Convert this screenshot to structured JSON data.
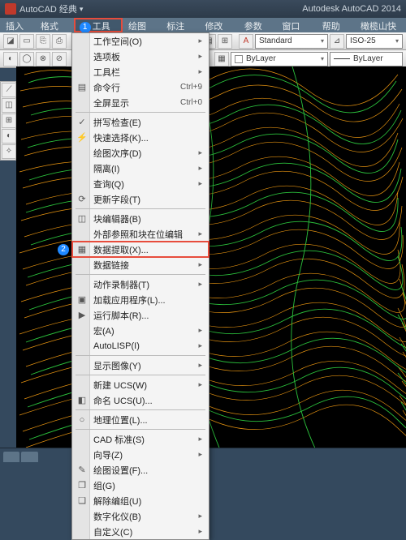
{
  "titlebar": {
    "left": "AutoCAD 经典",
    "right": "Autodesk AutoCAD 2014"
  },
  "menubar": {
    "items": [
      "插入(I)",
      "格式(O)",
      "工具(T)",
      "绘图(D)",
      "标注(N)",
      "修改(M)",
      "参数(P)",
      "窗口(W)",
      "帮助(H)",
      "橄榄山快模"
    ],
    "highlight_index": 2,
    "marker": "1"
  },
  "toolbar2": {
    "combo_standard": "Standard",
    "combo_iso": "ISO-25",
    "combo_bylayer1": "ByLayer",
    "combo_bylayer2": "ByLayer"
  },
  "dropdown": {
    "marker": "2",
    "groups": [
      [
        {
          "label": "工作空间(O)",
          "sub": "▸",
          "icon": ""
        },
        {
          "label": "选项板",
          "sub": "▸",
          "icon": ""
        },
        {
          "label": "工具栏",
          "sub": "▸",
          "icon": ""
        },
        {
          "label": "命令行",
          "shortcut": "Ctrl+9",
          "icon": "▤"
        },
        {
          "label": "全屏显示",
          "shortcut": "Ctrl+0",
          "icon": ""
        }
      ],
      [
        {
          "label": "拼写检查(E)",
          "icon": "✓"
        },
        {
          "label": "快速选择(K)...",
          "icon": "⚡"
        },
        {
          "label": "绘图次序(D)",
          "sub": "▸",
          "icon": ""
        },
        {
          "label": "隔离(I)",
          "sub": "▸",
          "icon": ""
        },
        {
          "label": "查询(Q)",
          "sub": "▸",
          "icon": ""
        },
        {
          "label": "更新字段(T)",
          "icon": "⟳"
        }
      ],
      [
        {
          "label": "块编辑器(B)",
          "icon": "◫"
        },
        {
          "label": "外部参照和块在位编辑",
          "sub": "▸",
          "icon": ""
        },
        {
          "label": "数据提取(X)...",
          "icon": "▦",
          "highlight": true
        },
        {
          "label": "数据链接",
          "sub": "▸",
          "icon": ""
        }
      ],
      [
        {
          "label": "动作录制器(T)",
          "sub": "▸",
          "icon": ""
        },
        {
          "label": "加载应用程序(L)...",
          "icon": "▣"
        },
        {
          "label": "运行脚本(R)...",
          "icon": "▶"
        },
        {
          "label": "宏(A)",
          "sub": "▸",
          "icon": ""
        },
        {
          "label": "AutoLISP(I)",
          "sub": "▸",
          "icon": ""
        }
      ],
      [
        {
          "label": "显示图像(Y)",
          "sub": "▸",
          "icon": ""
        }
      ],
      [
        {
          "label": "新建 UCS(W)",
          "sub": "▸",
          "icon": ""
        },
        {
          "label": "命名 UCS(U)...",
          "icon": "◧"
        }
      ],
      [
        {
          "label": "地理位置(L)...",
          "icon": "○"
        }
      ],
      [
        {
          "label": "CAD 标准(S)",
          "sub": "▸",
          "icon": ""
        },
        {
          "label": "向导(Z)",
          "sub": "▸",
          "icon": ""
        },
        {
          "label": "绘图设置(F)...",
          "icon": "✎"
        },
        {
          "label": "组(G)",
          "icon": "❐"
        },
        {
          "label": "解除编组(U)",
          "icon": "❏"
        },
        {
          "label": "数字化仪(B)",
          "sub": "▸",
          "icon": ""
        },
        {
          "label": "自定义(C)",
          "sub": "▸",
          "icon": ""
        }
      ]
    ]
  },
  "statusbar": {
    "tabs": [
      "",
      ""
    ]
  }
}
